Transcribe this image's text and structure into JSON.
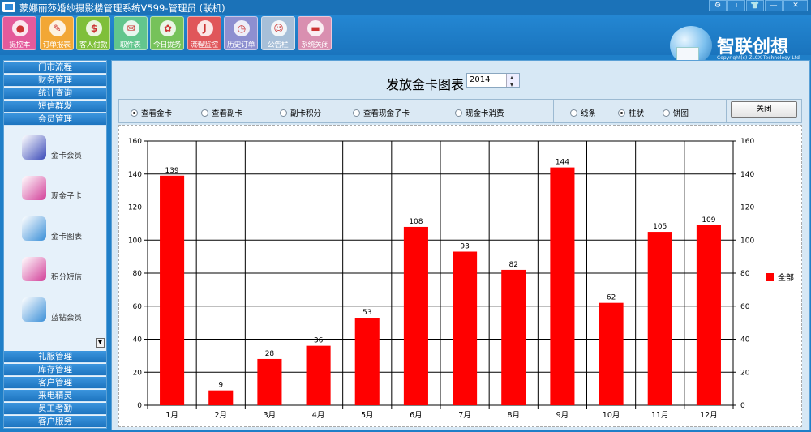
{
  "window": {
    "title": "蒙娜丽莎婚纱摄影楼管理系统V599-管理员 (联机)",
    "buttons": [
      "⚙",
      "i",
      "👕",
      "—",
      "✕"
    ]
  },
  "toolbar": {
    "items": [
      {
        "label": "摄控本",
        "color": "#e45a9b",
        "glyph": "●"
      },
      {
        "label": "订单报表",
        "color": "#f2a735",
        "glyph": "✎"
      },
      {
        "label": "客人付款",
        "color": "#7fbf3a",
        "glyph": "$"
      },
      {
        "label": "取件表",
        "color": "#62c68d",
        "glyph": "✉"
      },
      {
        "label": "今日拢务",
        "color": "#76c25a",
        "glyph": "✿"
      },
      {
        "label": "流程监控",
        "color": "#e0565a",
        "glyph": "J"
      },
      {
        "label": "历史订单",
        "color": "#8d8fd0",
        "glyph": "◷"
      },
      {
        "label": "公告栏",
        "color": "#a7bfd8",
        "glyph": "☺"
      },
      {
        "label": "系统关闭",
        "color": "#d98fb0",
        "glyph": "▬"
      }
    ]
  },
  "brand": {
    "name": "智联创想",
    "subtitle": "Copyright(c) ZLCX Technology Ltd"
  },
  "sidebar": {
    "top_groups": [
      "门市流程",
      "财务管理",
      "统计查询",
      "短信群发",
      "会员管理"
    ],
    "sub_items": [
      {
        "label": "金卡会员",
        "icon": "vip-icon",
        "color": "#3a4ab8"
      },
      {
        "label": "现金子卡",
        "icon": "card-icon",
        "color": "#d23e98"
      },
      {
        "label": "金卡图表",
        "icon": "chart-icon",
        "color": "#3a8fd8"
      },
      {
        "label": "积分短信",
        "icon": "coins-icon",
        "color": "#d23e98"
      },
      {
        "label": "蓝钻会员",
        "icon": "diamond-icon",
        "color": "#3a8fd8"
      }
    ],
    "bottom_groups": [
      "礼服管理",
      "库存管理",
      "客户管理",
      "来电精灵",
      "员工考勤",
      "客户服务"
    ]
  },
  "main": {
    "title": "发放金卡图表",
    "year": "2014",
    "view_options": [
      {
        "label": "查看金卡",
        "selected": true
      },
      {
        "label": "查看副卡",
        "selected": false
      },
      {
        "label": "副卡积分",
        "selected": false
      },
      {
        "label": "查看现金子卡",
        "selected": false
      },
      {
        "label": "现金卡消费",
        "selected": false
      }
    ],
    "chart_options": [
      {
        "label": "线条",
        "selected": false
      },
      {
        "label": "柱状",
        "selected": true
      },
      {
        "label": "饼图",
        "selected": false
      }
    ],
    "close_label": "关闭"
  },
  "chart_data": {
    "type": "bar",
    "categories": [
      "1月",
      "2月",
      "3月",
      "4月",
      "5月",
      "6月",
      "7月",
      "8月",
      "9月",
      "10月",
      "11月",
      "12月"
    ],
    "series": [
      {
        "name": "全部",
        "values": [
          139,
          9,
          28,
          36,
          53,
          108,
          93,
          82,
          144,
          62,
          105,
          109
        ],
        "color": "#ff0000"
      }
    ],
    "ylim": [
      0,
      160
    ],
    "yticks": [
      0,
      20,
      40,
      60,
      80,
      100,
      120,
      140,
      160
    ],
    "grid": true,
    "legend": "right",
    "title": "",
    "xlabel": "",
    "ylabel": ""
  }
}
